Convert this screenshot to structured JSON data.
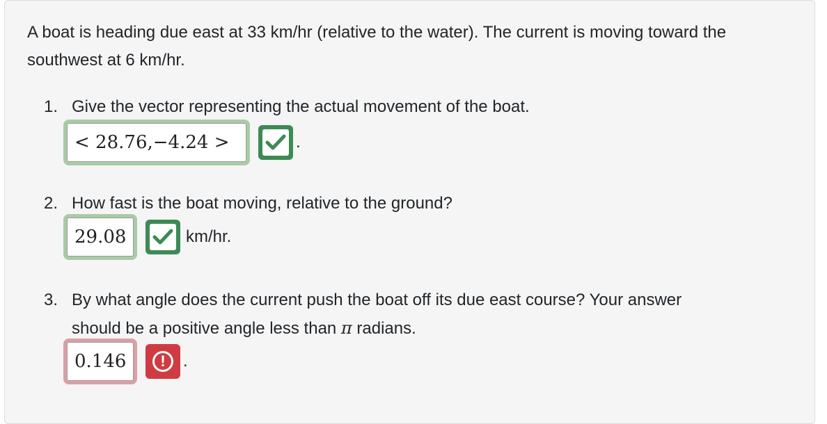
{
  "intro": "A boat is heading due east at 33 km/hr (relative to the water). The current is moving toward the southwest at 6 km/hr.",
  "questions": [
    {
      "number": "1.",
      "text": "Give the vector representing the actual movement of the boat.",
      "answer": "< 28.76,−4.24 >",
      "status": "correct",
      "after": "."
    },
    {
      "number": "2.",
      "text": "How fast is the boat moving, relative to the ground?",
      "answer": "29.08",
      "status": "correct",
      "after": "km/hr."
    },
    {
      "number": "3.",
      "text_line1": "By what angle does the current push the boat off its due east course? Your answer",
      "text_line2_pre": "should be a positive angle less than",
      "text_line2_symbol": "π",
      "text_line2_post": "radians.",
      "answer": "0.146",
      "status": "incorrect",
      "after": "."
    }
  ],
  "colors": {
    "correct_badge": "#3c8a55",
    "incorrect_badge": "#cf3b42",
    "correct_frame": "#a8cca5",
    "incorrect_frame": "#d9a0a6"
  },
  "icons": {
    "correct": "checkmark-icon",
    "incorrect": "exclamation-circle-icon"
  }
}
